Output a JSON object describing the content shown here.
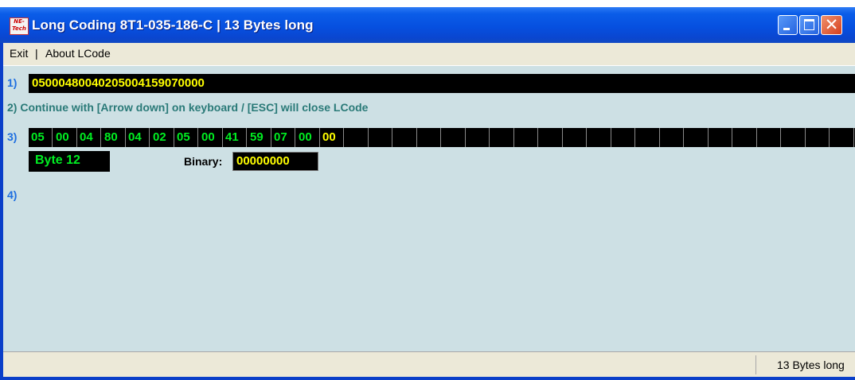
{
  "window": {
    "title": "Long Coding  8T1-035-186-C  |  13 Bytes long",
    "icon_text": "NE-Tech"
  },
  "menu": {
    "items": [
      "Exit",
      "|",
      "About LCode"
    ]
  },
  "rows": {
    "row1_label": "1)",
    "row1_hex": "05000480040205004159070000",
    "row2_text": "2) Continue with [Arrow down] on keyboard / [ESC] will close LCode",
    "row3_label": "3)",
    "row4_label": "4)"
  },
  "bytes": [
    {
      "value": "05",
      "color": "green"
    },
    {
      "value": "00",
      "color": "green"
    },
    {
      "value": "04",
      "color": "green"
    },
    {
      "value": "80",
      "color": "green"
    },
    {
      "value": "04",
      "color": "green"
    },
    {
      "value": "02",
      "color": "green"
    },
    {
      "value": "05",
      "color": "green"
    },
    {
      "value": "00",
      "color": "green"
    },
    {
      "value": "41",
      "color": "green"
    },
    {
      "value": "59",
      "color": "green"
    },
    {
      "value": "07",
      "color": "green"
    },
    {
      "value": "00",
      "color": "green"
    },
    {
      "value": "00",
      "color": "yellow"
    }
  ],
  "selected": {
    "byte_label": "Byte 12",
    "binary_label": "Binary:",
    "binary_value": "00000000"
  },
  "status": {
    "text": "13 Bytes long"
  },
  "colors": {
    "title_bar": "#0650e0",
    "client_bg": "#cde0e4",
    "byte_green": "#00ee22",
    "byte_yellow": "#ffff00",
    "label_blue": "#1f6fe0"
  }
}
